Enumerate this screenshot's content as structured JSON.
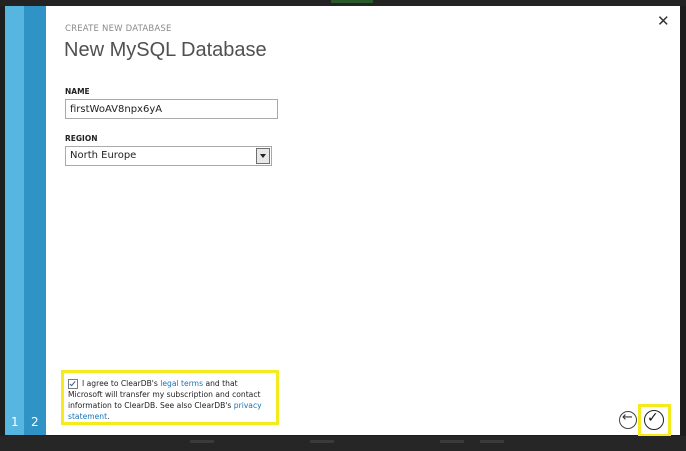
{
  "dialog": {
    "kicker": "CREATE NEW DATABASE",
    "title": "New MySQL Database",
    "close_icon": "close-icon"
  },
  "wizard": {
    "steps": [
      {
        "label": "1"
      },
      {
        "label": "2"
      }
    ]
  },
  "form": {
    "name": {
      "label": "NAME",
      "value": "firstWoAV8npx6yA"
    },
    "region": {
      "label": "REGION",
      "selected": "North Europe"
    }
  },
  "agreement": {
    "checked": true,
    "text_1": "I agree to ClearDB's ",
    "link_legal": "legal terms",
    "text_2": " and that Microsoft will transfer my subscription and contact information to ClearDB. See also ClearDB's ",
    "link_privacy": "privacy statement",
    "text_3": "."
  },
  "nav": {
    "back_icon": "arrow-left-icon",
    "finish_icon": "checkmark-icon"
  },
  "colors": {
    "wizard_bar": "#3aa0d0",
    "highlight": "#f4ea1c",
    "link": "#1a73b5"
  }
}
